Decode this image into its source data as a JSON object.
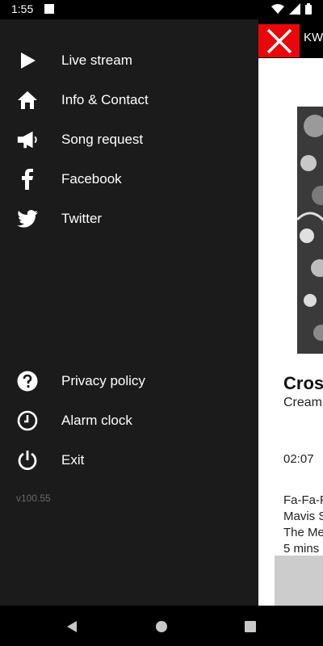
{
  "status_bar": {
    "time": "1:55"
  },
  "app": {
    "station_name": "KW",
    "song_title": "Cros",
    "song_artist": "Cream",
    "elapsed": "02:07",
    "history_lines": [
      "Fa-Fa-F",
      "Mavis S",
      "The Me",
      "5 mins"
    ]
  },
  "drawer": {
    "top_items": [
      {
        "label": "Live stream",
        "icon": "play-icon"
      },
      {
        "label": "Info & Contact",
        "icon": "home-icon"
      },
      {
        "label": "Song request",
        "icon": "megaphone-icon"
      },
      {
        "label": "Facebook",
        "icon": "facebook-icon"
      },
      {
        "label": "Twitter",
        "icon": "twitter-icon"
      }
    ],
    "bottom_items": [
      {
        "label": "Privacy policy",
        "icon": "question-icon"
      },
      {
        "label": "Alarm clock",
        "icon": "clock-icon"
      },
      {
        "label": "Exit",
        "icon": "power-icon"
      }
    ],
    "version": "v100.55"
  },
  "colors": {
    "drawer_bg": "#1b1b1b",
    "accent_red": "#e8070b",
    "text": "#ffffff",
    "muted": "#6a6a6a"
  }
}
